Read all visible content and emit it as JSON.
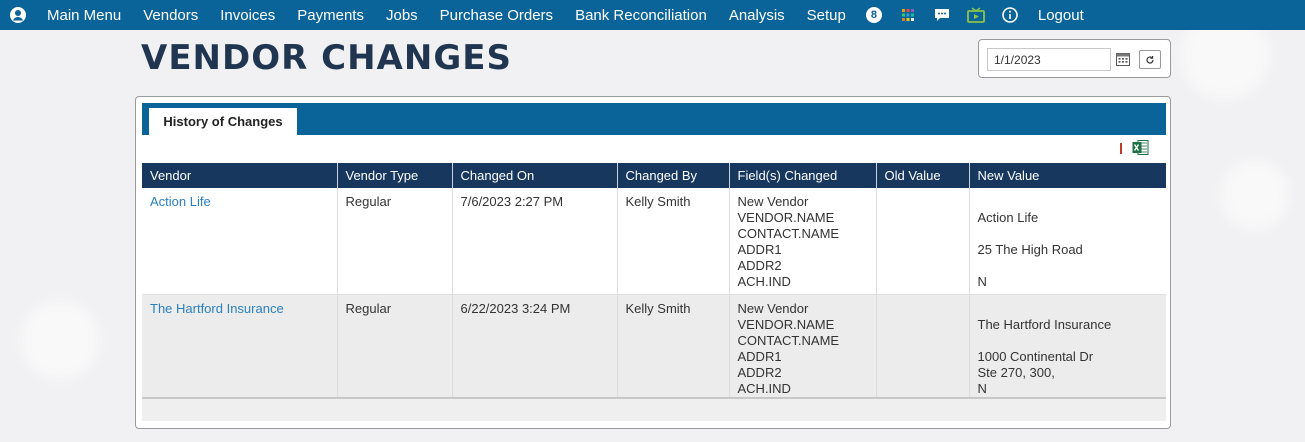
{
  "nav": {
    "items": [
      "Main Menu",
      "Vendors",
      "Invoices",
      "Payments",
      "Jobs",
      "Purchase Orders",
      "Bank Reconciliation",
      "Analysis",
      "Setup"
    ],
    "badge_count": "8",
    "logout": "Logout",
    "icons": [
      "user-icon",
      "apps-grid-icon",
      "chat-icon",
      "tv-icon",
      "info-icon"
    ]
  },
  "page": {
    "title": "VENDOR CHANGES"
  },
  "filter": {
    "date_value": "1/1/2023"
  },
  "panel": {
    "tab_label": "History of Changes"
  },
  "table": {
    "columns": [
      "Vendor",
      "Vendor Type",
      "Changed On",
      "Changed By",
      "Field(s) Changed",
      "Old Value",
      "New Value"
    ],
    "rows": [
      {
        "vendor": "Action Life",
        "vendor_type": "Regular",
        "changed_on": "7/6/2023 2:27 PM",
        "changed_by": "Kelly Smith",
        "fields": [
          "New Vendor",
          "VENDOR.NAME",
          "CONTACT.NAME",
          "ADDR1",
          "ADDR2",
          "ACH.IND"
        ],
        "old_values": [
          "",
          "",
          "",
          "",
          "",
          ""
        ],
        "new_values": [
          "",
          "Action Life",
          "",
          "25 The High Road",
          "",
          "N"
        ]
      },
      {
        "vendor": "The Hartford Insurance",
        "vendor_type": "Regular",
        "changed_on": "6/22/2023 3:24 PM",
        "changed_by": "Kelly Smith",
        "fields": [
          "New Vendor",
          "VENDOR.NAME",
          "CONTACT.NAME",
          "ADDR1",
          "ADDR2",
          "ACH.IND"
        ],
        "old_values": [
          "",
          "",
          "",
          "",
          "",
          ""
        ],
        "new_values": [
          "",
          "The Hartford Insurance",
          "",
          "1000 Continental Dr",
          "Ste 270, 300,",
          "N"
        ]
      }
    ]
  },
  "colors": {
    "nav_bg": "#0a6399",
    "header_bg": "#17375e",
    "link": "#2a7fc0",
    "title": "#1f3550"
  }
}
